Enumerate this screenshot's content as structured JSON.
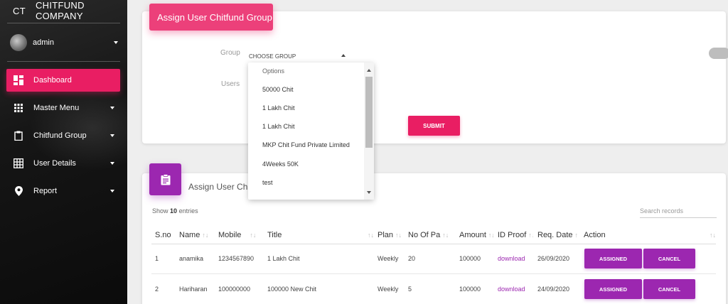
{
  "sidebar": {
    "logo": "CT",
    "company": "CHITFUND COMPANY",
    "user": "admin",
    "items": [
      {
        "label": "Dashboard"
      },
      {
        "label": "Master Menu"
      },
      {
        "label": "Chitfund Group"
      },
      {
        "label": "User Details"
      },
      {
        "label": "Report"
      }
    ]
  },
  "assign_form": {
    "title": "Assign User Chitfund Group",
    "group_label": "Group",
    "group_value": "CHOOSE GROUP",
    "users_label": "Users",
    "submit_label": "SUBMIT"
  },
  "dropdown": {
    "options": [
      "Options",
      "50000 Chit",
      "1 Lakh Chit",
      "1 Lakh Chit",
      "MKP Chit Fund Private Limited",
      "4Weeks 50K",
      "test"
    ]
  },
  "list_card": {
    "title": "Assign User Chitfund Group",
    "show_prefix": "Show",
    "show_count": "10",
    "show_suffix": "entries",
    "search_placeholder": "Search records"
  },
  "table": {
    "headers": [
      "S.no",
      "Name",
      "Mobile",
      "Title",
      "Plan",
      "No Of Pa",
      "Amount",
      "ID Proof",
      "Req. Date",
      "Action"
    ],
    "rows": [
      {
        "sno": "1",
        "name": "anamika",
        "mobile": "1234567890",
        "title": "1 Lakh Chit",
        "plan": "Weekly",
        "no": "20",
        "amount": "100000",
        "proof": "download",
        "date": "26/09/2020",
        "assign": "ASSIGNED",
        "cancel": "CANCEL"
      },
      {
        "sno": "2",
        "name": "Hariharan",
        "mobile": "100000000",
        "title": "100000 New Chit",
        "plan": "Weekly",
        "no": "5",
        "amount": "100000",
        "proof": "download",
        "date": "24/09/2020",
        "assign": "ASSIGNED",
        "cancel": "CANCEL"
      }
    ]
  },
  "colors": {
    "primary": "#e91e63",
    "accent": "#9c27b0"
  }
}
